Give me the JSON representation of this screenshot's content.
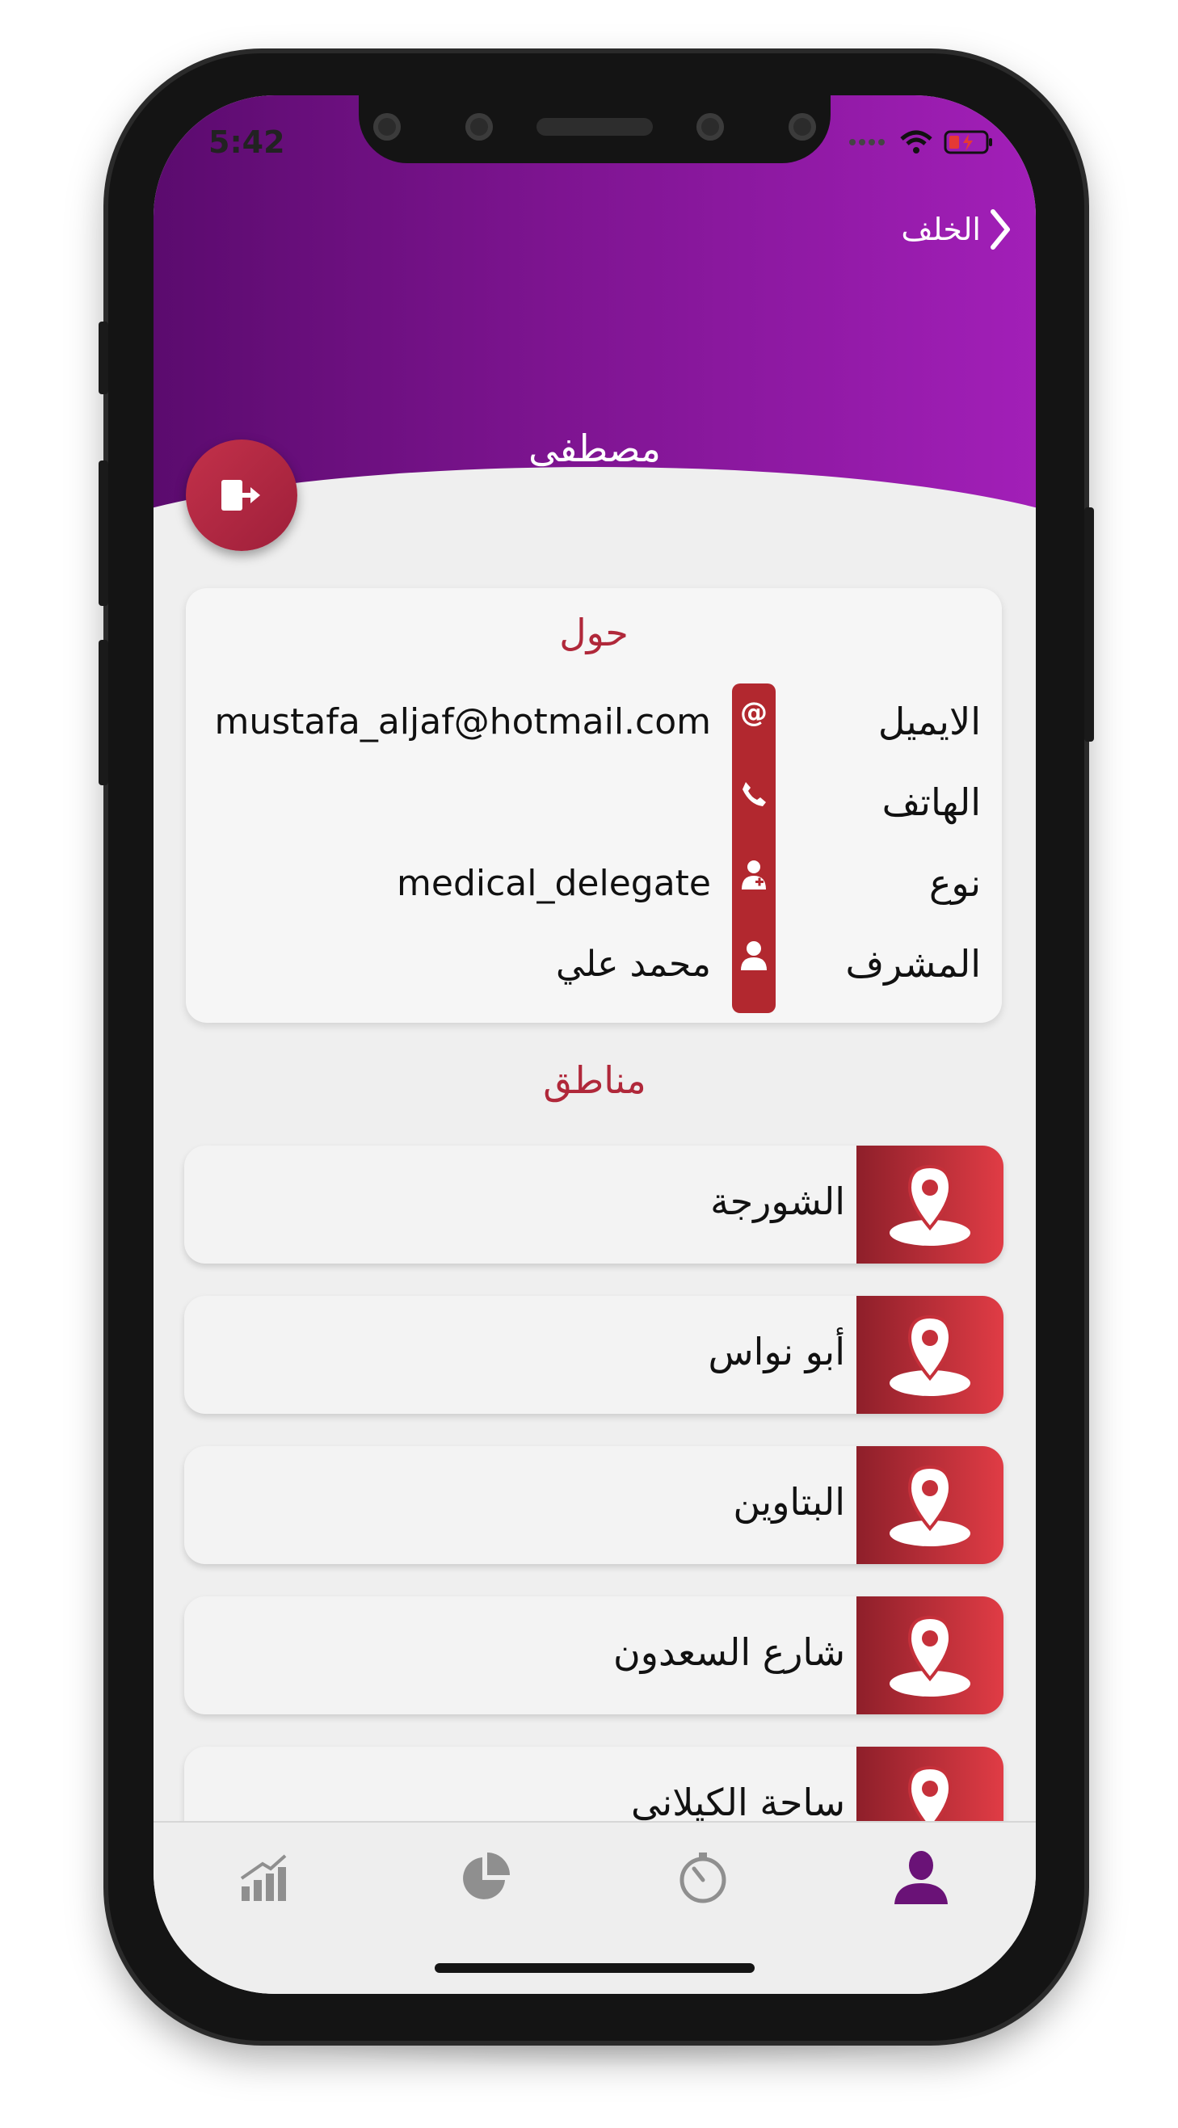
{
  "status_bar": {
    "time": "5:42"
  },
  "header": {
    "back_label": "الخلف",
    "title": "مصطفى"
  },
  "about": {
    "title": "حول",
    "rows": [
      {
        "label": "الايميل",
        "value": "mustafa_aljaf@hotmail.com",
        "icon": "at-icon"
      },
      {
        "label": "الهاتف",
        "value": "",
        "icon": "phone-icon"
      },
      {
        "label": "نوع",
        "value": "medical_delegate",
        "icon": "doctor-icon"
      },
      {
        "label": "المشرف",
        "value": "محمد علي",
        "icon": "user-icon"
      }
    ]
  },
  "regions": {
    "title": "مناطق",
    "items": [
      {
        "name": "الشورجة",
        "icon": "map-pin-icon"
      },
      {
        "name": "أبو نواس",
        "icon": "map-pin-icon"
      },
      {
        "name": "البتاوين",
        "icon": "map-pin-icon"
      },
      {
        "name": "شارع السعدون",
        "icon": "map-pin-icon"
      },
      {
        "name": "ساحة الكيلاني",
        "icon": "map-pin-icon"
      }
    ]
  },
  "tabbar": {
    "tabs": [
      {
        "icon": "bar-chart-icon",
        "active": false
      },
      {
        "icon": "pie-chart-icon",
        "active": false
      },
      {
        "icon": "timer-icon",
        "active": false
      },
      {
        "icon": "person-icon",
        "active": true
      }
    ]
  },
  "colors": {
    "header_start": "#5b0b6e",
    "header_end": "#a21fb8",
    "accent_red": "#b0283a",
    "active_tab": "#6a1277",
    "inactive_tab": "#8f8f8f"
  }
}
